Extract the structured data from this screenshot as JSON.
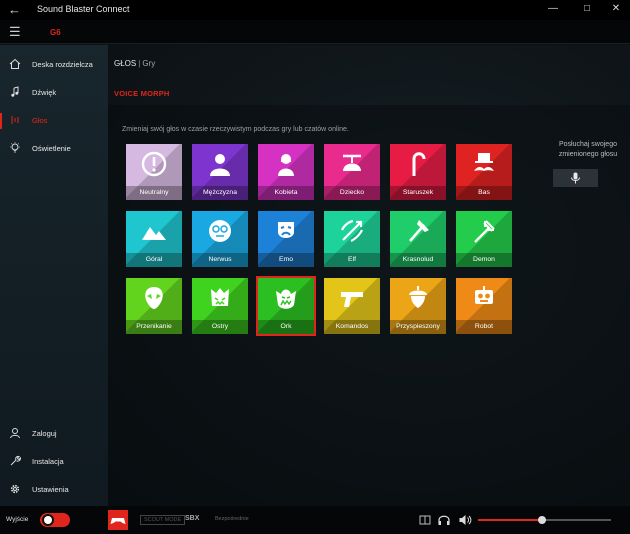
{
  "window": {
    "title": "Sound Blaster Connect"
  },
  "header": {
    "device": "G6"
  },
  "sidebar": {
    "items": [
      {
        "label": "Deska rozdzielcza",
        "icon": "home-icon",
        "active": false
      },
      {
        "label": "Dźwięk",
        "icon": "music-note-icon",
        "active": false
      },
      {
        "label": "Głos",
        "icon": "voice-icon",
        "active": true
      },
      {
        "label": "Oświetlenie",
        "icon": "lightbulb-icon",
        "active": false
      }
    ],
    "bottom_items": [
      {
        "label": "Zaloguj",
        "icon": "user-icon"
      },
      {
        "label": "Instalacja",
        "icon": "wrench-icon"
      },
      {
        "label": "Ustawienia",
        "icon": "gear-icon"
      }
    ]
  },
  "breadcrumb": {
    "current": "GŁOS",
    "separator": "|",
    "sub": "Gry"
  },
  "section_title": "VOICE MORPH",
  "description": "Zmieniaj swój głos w czasie rzeczywistym podczas gry lub czatów online.",
  "preview": {
    "text": "Posłuchaj swojego zmienionego głosu",
    "icon": "microphone-icon"
  },
  "presets": [
    {
      "name": "Neutralny",
      "color": "#d6b9e0",
      "icon": "info-circle-icon"
    },
    {
      "name": "Mężczyzna",
      "color": "#7e35cf",
      "icon": "man-icon"
    },
    {
      "name": "Kobieta",
      "color": "#d532c4",
      "icon": "woman-icon"
    },
    {
      "name": "Dziecko",
      "color": "#ea2b8e",
      "icon": "propeller-hat-icon"
    },
    {
      "name": "Staruszek",
      "color": "#e61c45",
      "icon": "cane-icon"
    },
    {
      "name": "Bas",
      "color": "#df2222",
      "icon": "mustache-icon"
    },
    {
      "name": "Góral",
      "color": "#1fc6d0",
      "icon": "mountains-icon"
    },
    {
      "name": "Nerwus",
      "color": "#1aa8e2",
      "icon": "nerd-face-icon"
    },
    {
      "name": "Emo",
      "color": "#1e81d8",
      "icon": "drama-mask-icon"
    },
    {
      "name": "Elf",
      "color": "#1ed39a",
      "icon": "bow-arrow-icon"
    },
    {
      "name": "Krasnolud",
      "color": "#1fce6a",
      "icon": "axe-icon"
    },
    {
      "name": "Demon",
      "color": "#23cc4a",
      "icon": "trident-icon"
    },
    {
      "name": "Przenikanie",
      "color": "#63d41e",
      "icon": "alien-icon"
    },
    {
      "name": "Ostry",
      "color": "#3fd21e",
      "icon": "monster-icon"
    },
    {
      "name": "Ork",
      "color": "#2bbf21",
      "icon": "orc-icon",
      "selected": true
    },
    {
      "name": "Komandos",
      "color": "#e3c51a",
      "icon": "pistol-icon"
    },
    {
      "name": "Przyspieszony",
      "color": "#eba516",
      "icon": "acorn-icon"
    },
    {
      "name": "Robot",
      "color": "#ef8a16",
      "icon": "robot-icon"
    }
  ],
  "bottombar": {
    "exit_label": "Wyjście",
    "scout_label": "SCOUT MODE",
    "sbx_label": "SBX",
    "sbx_sub": "Bezpośrednie",
    "volume_percent": 48,
    "accent": "#e0261c"
  }
}
